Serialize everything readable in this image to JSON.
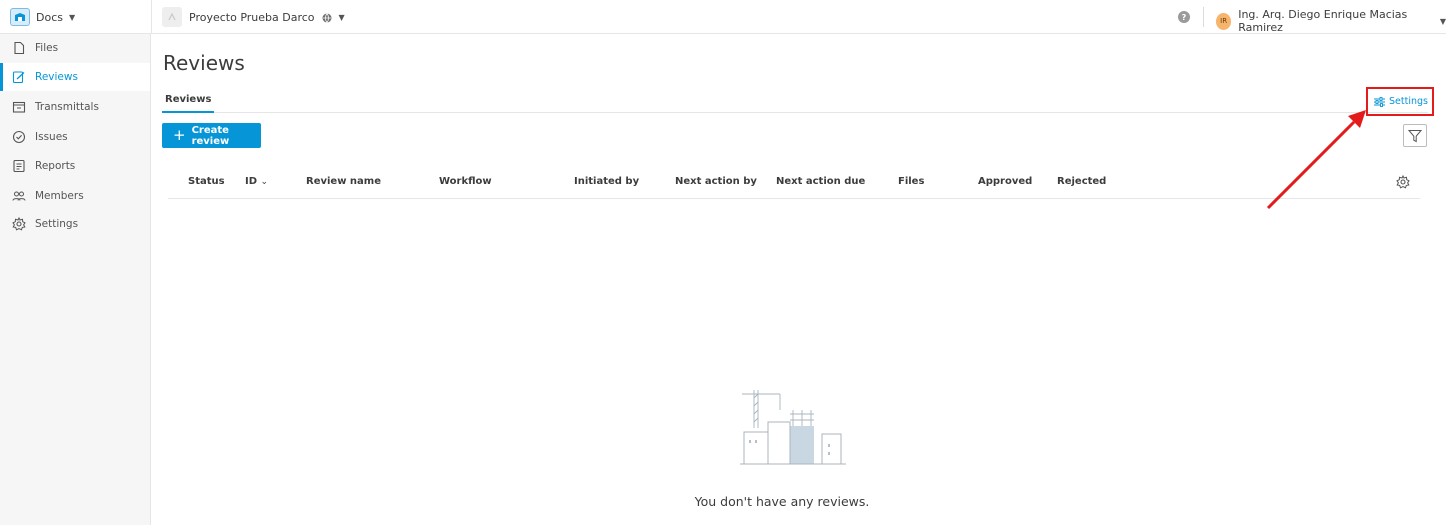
{
  "topbar": {
    "app_label": "Docs",
    "project_name": "Proyecto Prueba Darco",
    "help_label": "?",
    "user_initials": "IR",
    "user_name": "Ing. Arq. Diego Enrique Macias Ramirez"
  },
  "sidebar": {
    "items": [
      {
        "label": "Files",
        "icon": "file-icon",
        "active": false
      },
      {
        "label": "Reviews",
        "icon": "reviews-icon",
        "active": true
      },
      {
        "label": "Transmittals",
        "icon": "transmittals-icon",
        "active": false
      },
      {
        "label": "Issues",
        "icon": "issues-icon",
        "active": false
      },
      {
        "label": "Reports",
        "icon": "reports-icon",
        "active": false
      },
      {
        "label": "Members",
        "icon": "members-icon",
        "active": false
      },
      {
        "label": "Settings",
        "icon": "gear-icon",
        "active": false
      }
    ]
  },
  "main": {
    "title": "Reviews",
    "tabs": [
      {
        "label": "Reviews"
      }
    ],
    "settings_label": "Settings",
    "create_label": "Create review",
    "columns": [
      "Status",
      "ID",
      "Review name",
      "Workflow",
      "Initiated by",
      "Next action by",
      "Next action due",
      "Files",
      "Approved",
      "Rejected"
    ],
    "empty_text": "You don't have any reviews."
  },
  "colors": {
    "accent": "#0696d7",
    "annotation": "#e31b1b",
    "sidebar_bg": "#f6f6f6"
  }
}
